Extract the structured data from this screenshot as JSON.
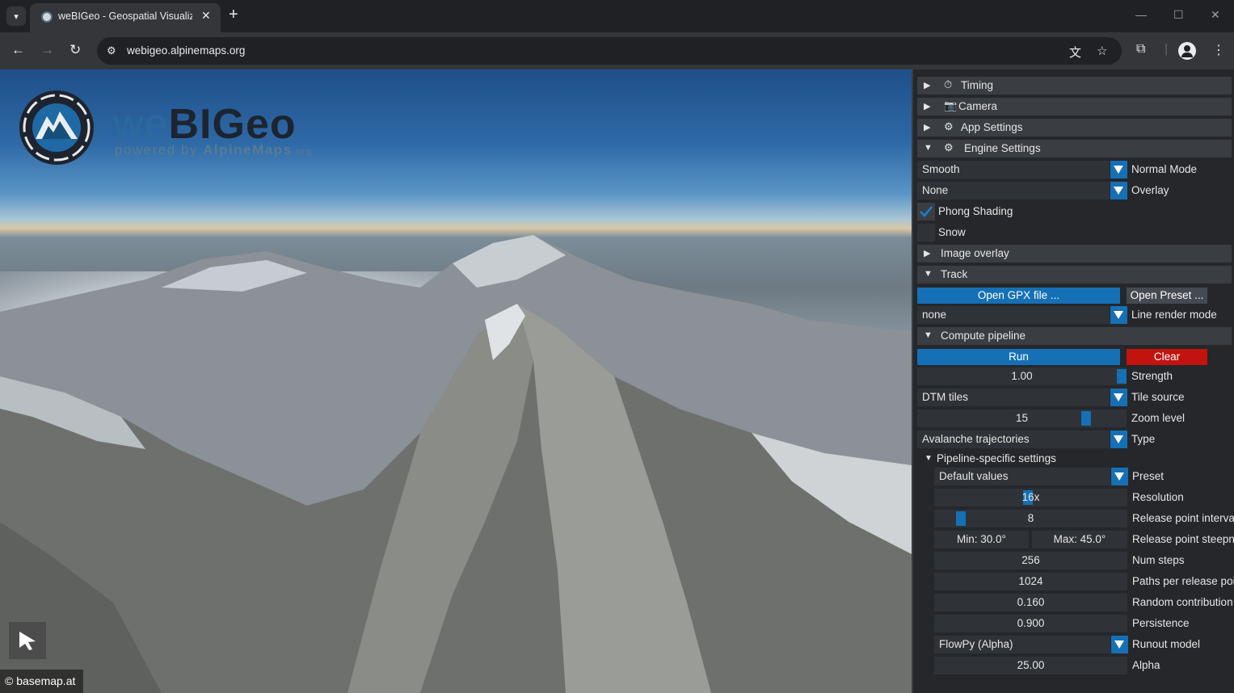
{
  "browser": {
    "tab_title": "weBIGeo - Geospatial Visualization",
    "url": "webigeo.alpinemaps.org"
  },
  "viewport": {
    "logo_title_a": "we",
    "logo_title_b": "BIG",
    "logo_title_c": "eo",
    "logo_sub_a": "powered by ",
    "logo_sub_b": "AlpineMaps",
    "logo_sub_c": ".org",
    "attribution": "© basemap.at"
  },
  "panel": {
    "timing": "Timing",
    "camera": "Camera",
    "app_settings": "App Settings",
    "engine_settings": "Engine Settings",
    "normal_mode_value": "Smooth",
    "normal_mode_label": "Normal Mode",
    "overlay_value": "None",
    "overlay_label": "Overlay",
    "phong_label": "Phong Shading",
    "phong_checked": true,
    "snow_label": "Snow",
    "snow_checked": false,
    "image_overlay": "Image overlay",
    "track": "Track",
    "open_gpx": "Open GPX file ...",
    "open_preset": "Open Preset ...",
    "line_render_value": "none",
    "line_render_label": "Line render mode",
    "compute_pipeline": "Compute pipeline",
    "run": "Run",
    "clear": "Clear",
    "strength_value": "1.00",
    "strength_label": "Strength",
    "tile_source_value": "DTM tiles",
    "tile_source_label": "Tile source",
    "zoom_value": "15",
    "zoom_label": "Zoom level",
    "type_value": "Avalanche trajectories",
    "type_label": "Type",
    "pipeline_specific": "Pipeline-specific settings",
    "preset_value": "Default values",
    "preset_label": "Preset",
    "resolution_value": "16x",
    "resolution_label": "Resolution",
    "release_interval_value": "8",
    "release_interval_label": "Release point interval",
    "steep_min": "Min: 30.0°",
    "steep_max": "Max: 45.0°",
    "steep_label": "Release point steepness",
    "num_steps_value": "256",
    "num_steps_label": "Num steps",
    "paths_value": "1024",
    "paths_label": "Paths per release point",
    "random_value": "0.160",
    "random_label": "Random contribution",
    "persistence_value": "0.900",
    "persistence_label": "Persistence",
    "runout_value": "FlowPy (Alpha)",
    "runout_label": "Runout model",
    "alpha_value": "25.00",
    "alpha_label": "Alpha"
  },
  "colors": {
    "accent_blue": "#1570b5",
    "danger_red": "#c2130f",
    "panel_bg": "#26282c"
  }
}
